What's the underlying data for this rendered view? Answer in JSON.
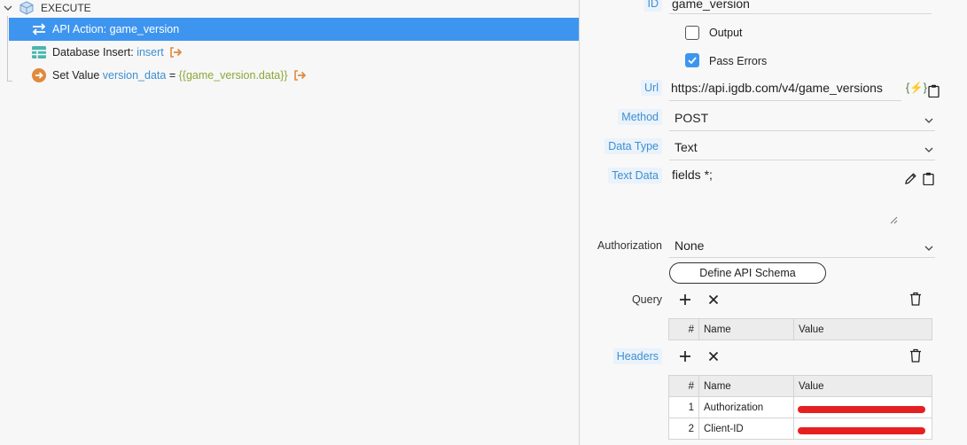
{
  "tree": {
    "root_label": "EXECUTE",
    "items": [
      {
        "prefix": "API Action: ",
        "name": "game_version",
        "selected": true
      },
      {
        "prefix": "Database Insert: ",
        "keyword": "insert"
      },
      {
        "prefix": "Set Value ",
        "keyword": "version_data",
        "equals": " = ",
        "template": "{{game_version.data}}"
      }
    ]
  },
  "form": {
    "id_label": "ID",
    "id_value": "game_version",
    "output_label": "Output",
    "output_checked": false,
    "pass_errors_label": "Pass Errors",
    "pass_errors_checked": true,
    "url_label": "Url",
    "url_value": "https://api.igdb.com/v4/game_versions",
    "url_tool_glyph": "{⚡}",
    "method_label": "Method",
    "method_value": "POST",
    "data_type_label": "Data Type",
    "data_type_value": "Text",
    "text_data_label": "Text Data",
    "text_data_value": "fields *;",
    "authorization_label": "Authorization",
    "authorization_value": "None",
    "define_schema_label": "Define API Schema",
    "query_label": "Query",
    "headers_label": "Headers"
  },
  "query_table": {
    "columns": [
      "#",
      "Name",
      "Value"
    ],
    "rows": []
  },
  "headers_table": {
    "columns": [
      "#",
      "Name",
      "Value"
    ],
    "rows": [
      {
        "num": "1",
        "name": "Authorization",
        "value_redacted": true
      },
      {
        "num": "2",
        "name": "Client-ID",
        "value_redacted": true
      }
    ]
  },
  "colors": {
    "selection": "#3e95ef",
    "field_label_blue": "#3d8fd1",
    "template_green": "#8aa838",
    "exit_icon_orange": "#e08a3c",
    "redaction_red": "#e62020"
  }
}
